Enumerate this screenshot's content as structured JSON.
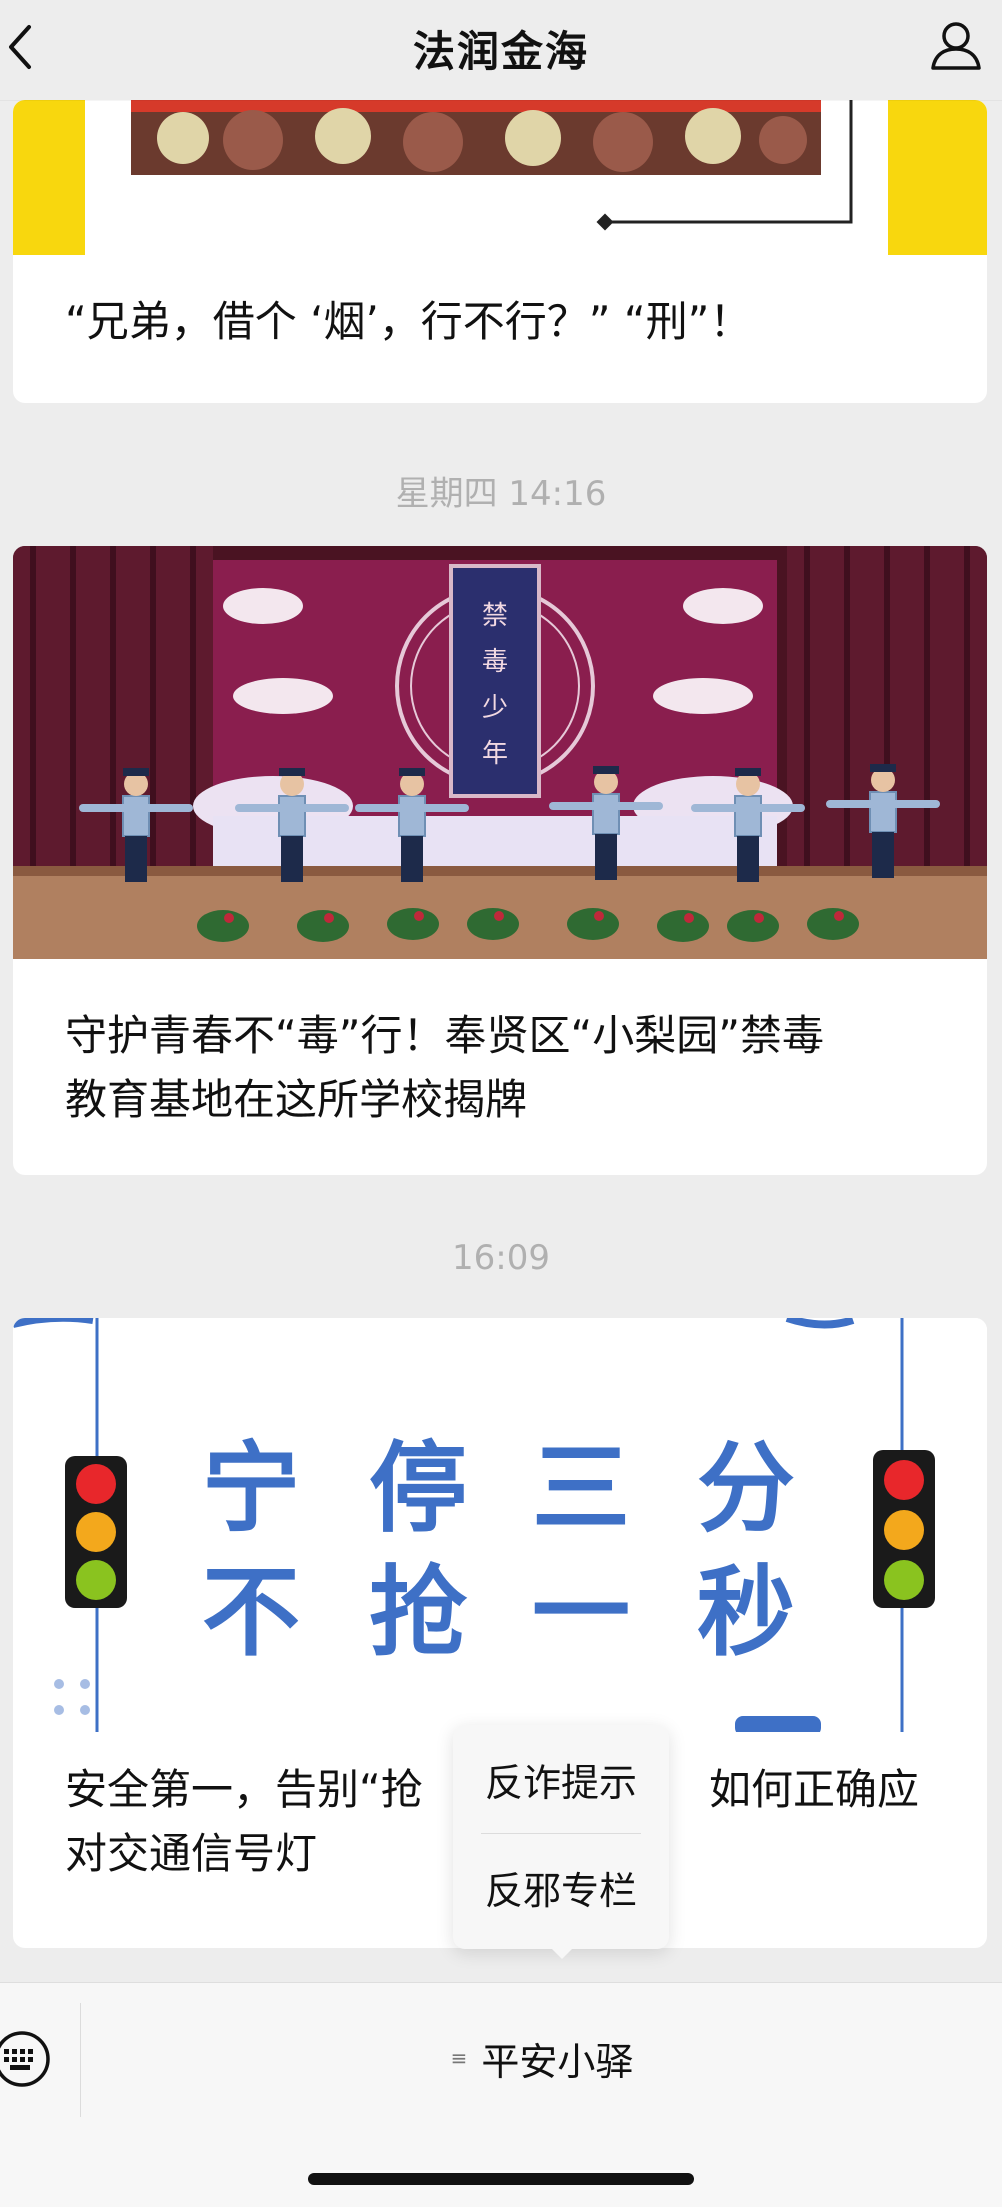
{
  "header": {
    "title": "法润金海",
    "back_icon": "chevron-left-icon",
    "profile_icon": "person-icon"
  },
  "articles": [
    {
      "title": "“兄弟，借个 ‘烟’，行不行？” “刑”！"
    },
    {
      "time": "星期四 14:16",
      "banner_text": [
        "禁",
        "毒",
        "少",
        "年"
      ],
      "title_line1": "守护青春不“毒”行！奉贤区“小梨园”禁毒",
      "title_line2": "教育基地在这所学校揭牌"
    },
    {
      "time": "16:09",
      "slogan_row1": [
        "宁",
        "停",
        "三",
        "分"
      ],
      "slogan_row2": [
        "不",
        "抢",
        "一",
        "秒"
      ],
      "title_line1_a": "安全第一，告别“抢",
      "title_line1_b": "如何正确应",
      "title_line2": "对交通信号灯"
    }
  ],
  "popup_menu": {
    "items": [
      "反诈提示",
      "反邪专栏"
    ]
  },
  "bottom_bar": {
    "keyboard_icon": "keyboard-icon",
    "menu_lines": "≡",
    "menu_label": "平安小驿"
  },
  "colors": {
    "background": "#ededed",
    "card": "#ffffff",
    "time_text": "#b0b0b0",
    "slogan_blue": "#3e70c6",
    "stage_purple": "#8a1e4e"
  }
}
